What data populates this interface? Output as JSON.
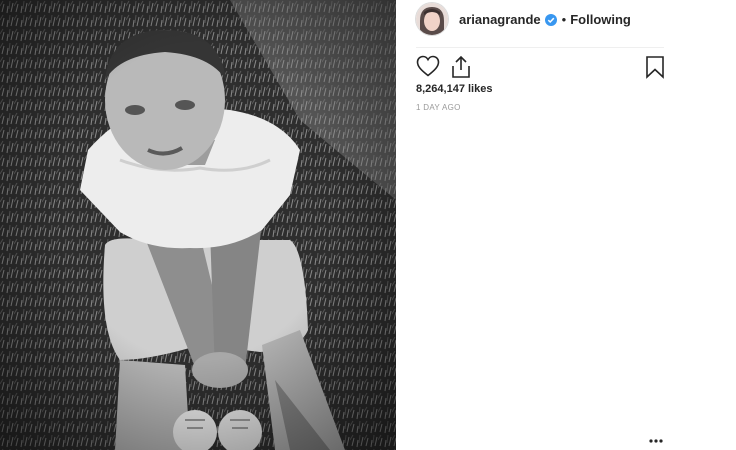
{
  "post": {
    "image_alt": "Black and white photo of a tattooed man in a white t-shirt sitting on grass",
    "author": {
      "username": "arianagrande",
      "verified": true,
      "follow_status": "Following"
    },
    "separator": "•",
    "likes_text": "8,264,147 likes",
    "timestamp": "1 DAY AGO",
    "icons": [
      "heart-icon",
      "share-icon",
      "bookmark-icon",
      "more-options-icon",
      "verified-badge-icon"
    ]
  },
  "colors": {
    "text": "#262626",
    "muted": "#999999",
    "verified": "#3897f0",
    "divider": "#efefef"
  }
}
